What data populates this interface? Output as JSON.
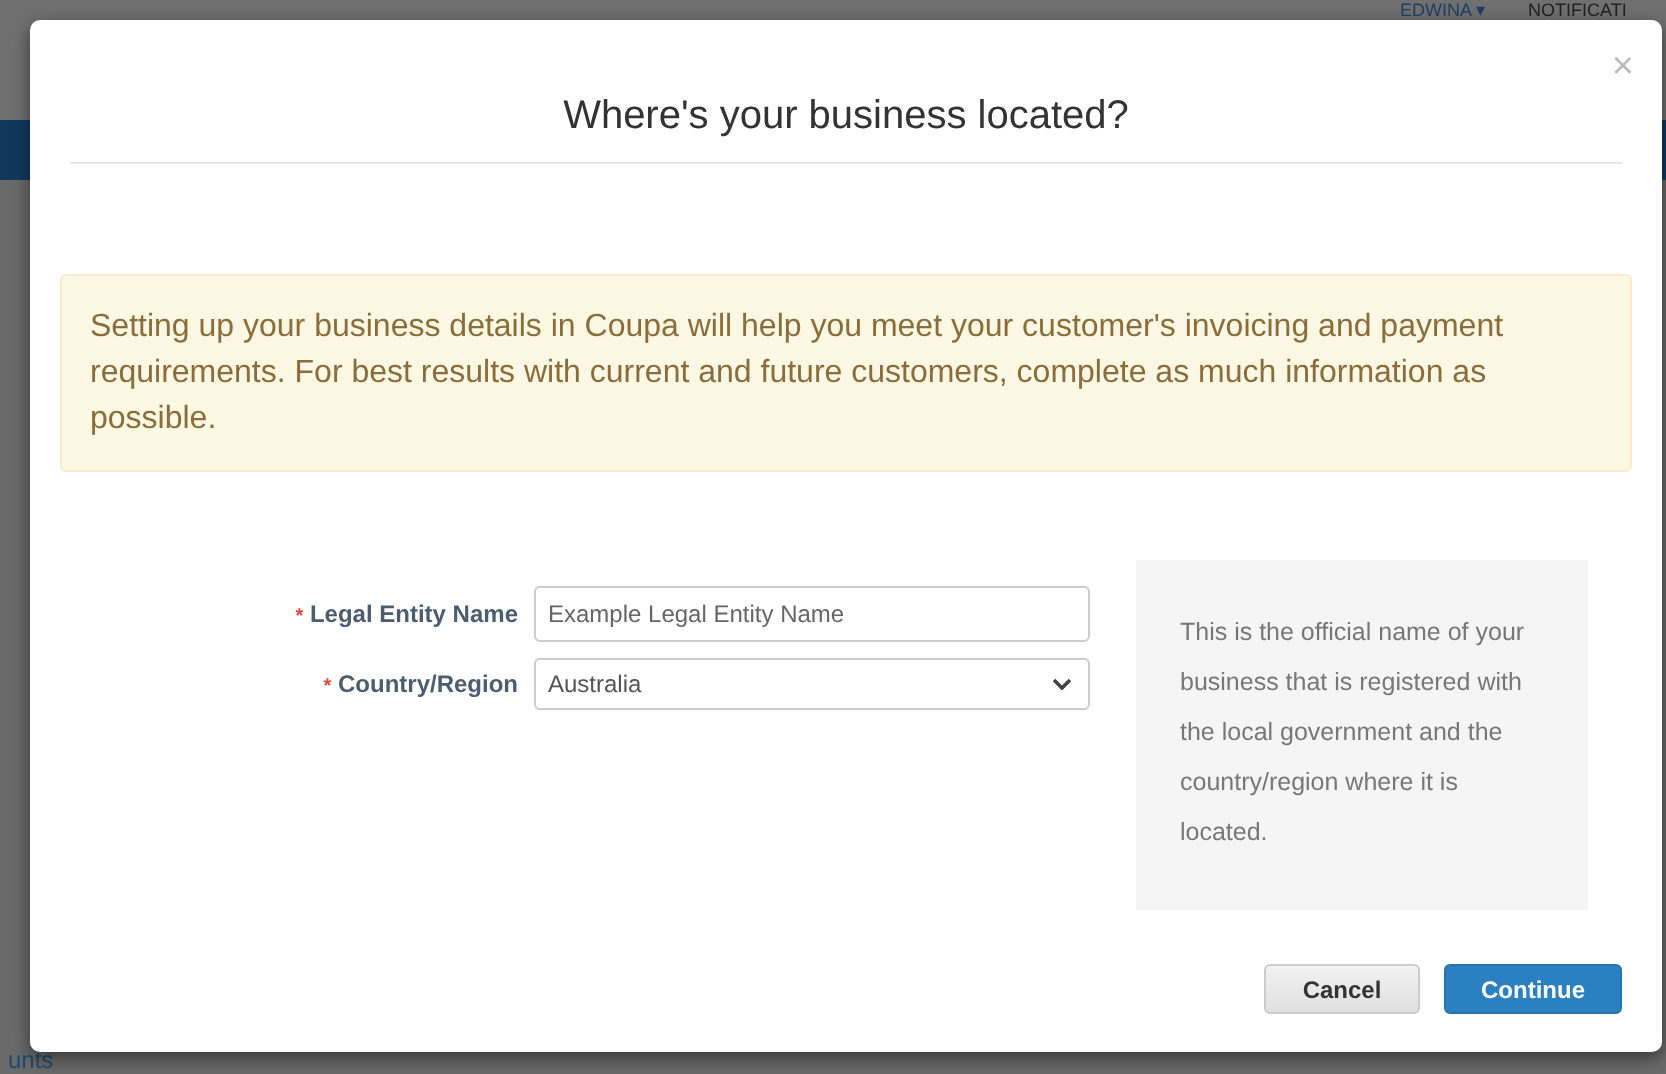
{
  "background": {
    "user": "EDWINA ▾",
    "notifications": "NOTIFICATI",
    "side_link": "unts"
  },
  "dialog": {
    "title": "Where's your business located?",
    "close": "×",
    "required_mark": "*",
    "alert": "Setting up your business details in Coupa will help you meet your customer's invoicing and payment requirements. For best results with current and future customers, complete as much information as possible.",
    "fields": [
      {
        "kind": "text",
        "label": "Legal Entity Name",
        "required": true,
        "placeholder": "Example Legal Entity Name"
      },
      {
        "kind": "select",
        "label": "Country/Region",
        "required": true,
        "value": "Australia"
      }
    ],
    "help": "This is the official name of your business that is registered with the local government and the country/region where it is located.",
    "buttons": [
      {
        "label": "Cancel",
        "kind": "secondary"
      },
      {
        "label": "Continue",
        "kind": "primary"
      }
    ]
  }
}
